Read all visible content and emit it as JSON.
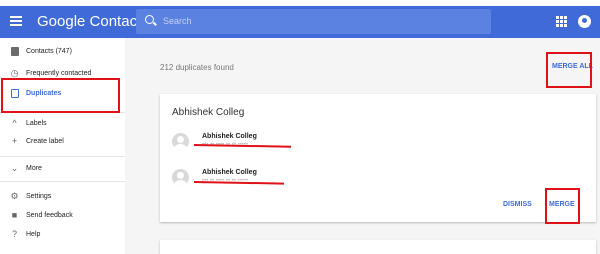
{
  "header": {
    "title": "Google Contacts",
    "search_placeholder": "Search"
  },
  "sidebar": {
    "items": [
      {
        "label": "Contacts (747)",
        "icon": "contacts-icon"
      },
      {
        "label": "Frequently contacted",
        "icon": "history-icon"
      },
      {
        "label": "Duplicates",
        "icon": "duplicates-icon",
        "active": true
      },
      {
        "label": "Labels",
        "icon": "chevron-up-icon"
      },
      {
        "label": "Create label",
        "icon": "plus-icon"
      },
      {
        "label": "More",
        "icon": "chevron-down-icon"
      },
      {
        "label": "Settings",
        "icon": "gear-icon"
      },
      {
        "label": "Send feedback",
        "icon": "feedback-icon"
      },
      {
        "label": "Help",
        "icon": "help-icon"
      }
    ]
  },
  "main": {
    "duplicates_found": "212 duplicates found",
    "merge_all_label": "MERGE ALL",
    "card": {
      "title": "Abhishek Colleg",
      "contacts": [
        {
          "name": "Abhishek Colleg",
          "detail": "••• •• •••• •• •• •••••"
        },
        {
          "name": "Abhishek Colleg",
          "detail": "••• •• •••• •• •• •••••"
        }
      ],
      "dismiss_label": "DISMISS",
      "merge_label": "MERGE"
    }
  },
  "colors": {
    "accent": "#3f6ad8",
    "annotation_red": "#e1111a"
  }
}
